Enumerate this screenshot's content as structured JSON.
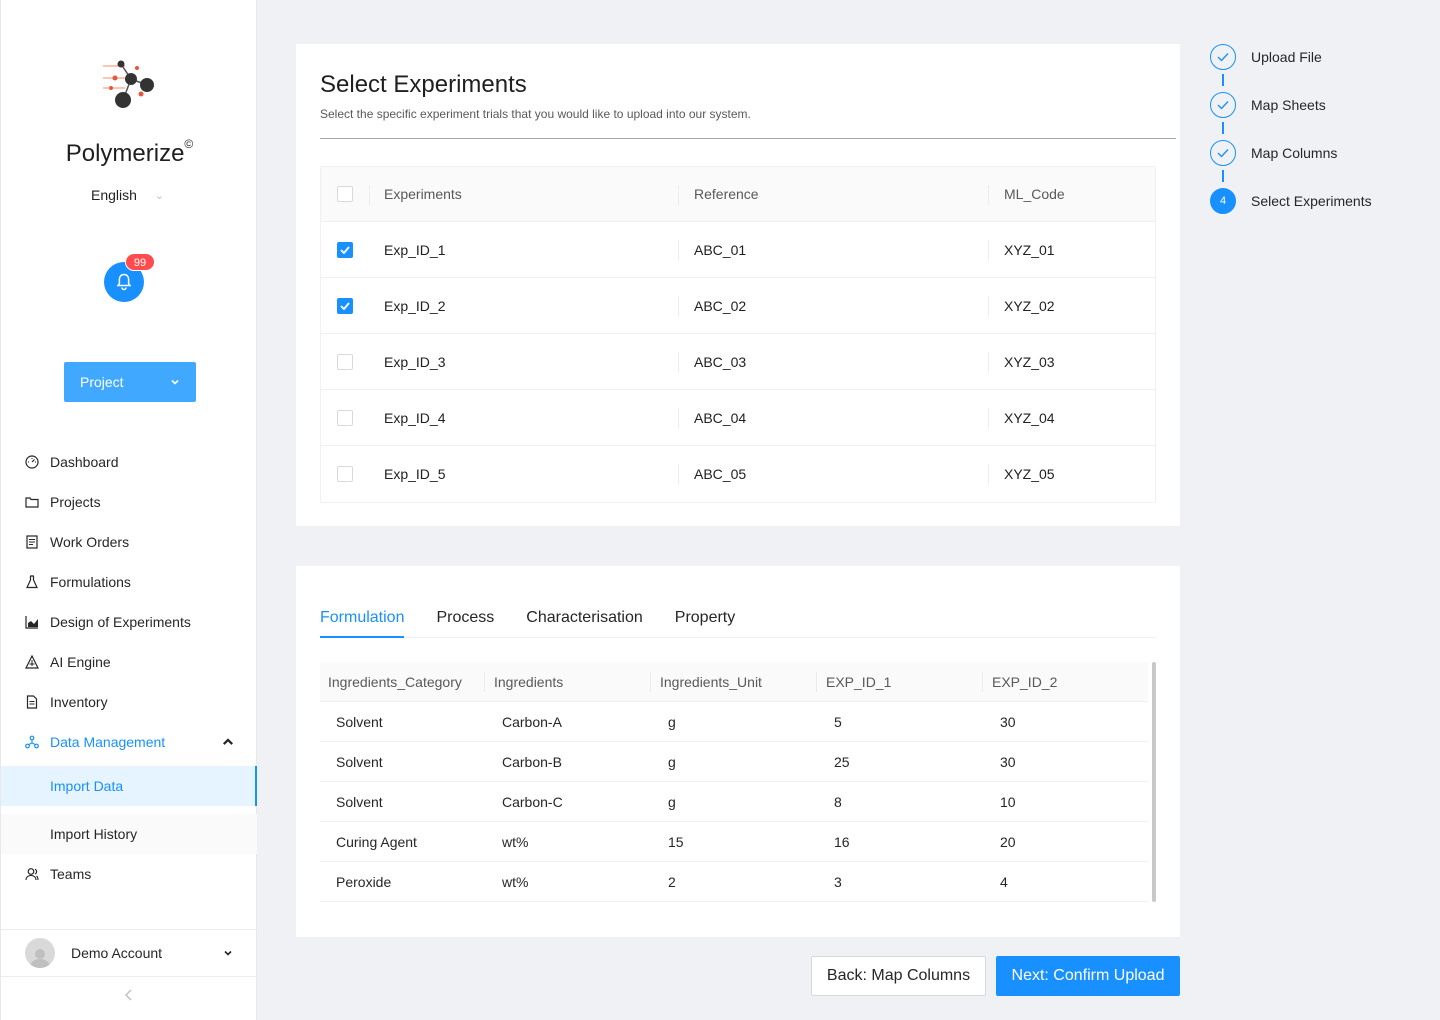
{
  "app": {
    "brand": "Polymerize",
    "brand_mark": "©",
    "language": "English",
    "notifications_count": "99",
    "project_button": "Project"
  },
  "nav": {
    "items": [
      {
        "label": "Dashboard",
        "icon": "dashboard-icon"
      },
      {
        "label": "Projects",
        "icon": "folder-icon"
      },
      {
        "label": "Work Orders",
        "icon": "work-order-icon"
      },
      {
        "label": "Formulations",
        "icon": "flask-icon"
      },
      {
        "label": "Design of Experiments",
        "icon": "chart-icon"
      },
      {
        "label": "AI Engine",
        "icon": "ai-engine-icon"
      },
      {
        "label": "Inventory",
        "icon": "inventory-icon"
      }
    ],
    "data_management": {
      "label": "Data Management",
      "icon": "data-management-icon"
    },
    "sub_items": [
      "Import Data",
      "Import History"
    ],
    "teams": {
      "label": "Teams",
      "icon": "teams-icon"
    }
  },
  "account": {
    "name": "Demo Account"
  },
  "colors": {
    "primary": "#1890ff",
    "badge": "#ff4d4f"
  },
  "select_experiments": {
    "title": "Select Experiments",
    "subtitle": "Select the specific experiment trials that you would like to upload into our system.",
    "columns": [
      "Experiments",
      "Reference",
      "ML_Code"
    ],
    "rows": [
      {
        "checked": true,
        "experiment": "Exp_ID_1",
        "reference": "ABC_01",
        "ml_code": "XYZ_01"
      },
      {
        "checked": true,
        "experiment": "Exp_ID_2",
        "reference": "ABC_02",
        "ml_code": "XYZ_02"
      },
      {
        "checked": false,
        "experiment": "Exp_ID_3",
        "reference": "ABC_03",
        "ml_code": "XYZ_03"
      },
      {
        "checked": false,
        "experiment": "Exp_ID_4",
        "reference": "ABC_04",
        "ml_code": "XYZ_04"
      },
      {
        "checked": false,
        "experiment": "Exp_ID_5",
        "reference": "ABC_05",
        "ml_code": "XYZ_05"
      }
    ]
  },
  "preview": {
    "tabs": [
      "Formulation",
      "Process",
      "Characterisation",
      "Property"
    ],
    "active_tab": "Formulation",
    "columns": [
      "Ingredients_Category",
      "Ingredients",
      "Ingredients_Unit",
      "EXP_ID_1",
      "EXP_ID_2"
    ],
    "rows": [
      [
        "Solvent",
        "Carbon-A",
        "g",
        "5",
        "30"
      ],
      [
        "Solvent",
        "Carbon-B",
        "g",
        "25",
        "30"
      ],
      [
        "Solvent",
        "Carbon-C",
        "g",
        "8",
        "10"
      ],
      [
        "Curing Agent",
        "wt%",
        "15",
        "16",
        "20"
      ],
      [
        "Peroxide",
        "wt%",
        "2",
        "3",
        "4"
      ]
    ]
  },
  "buttons": {
    "back": "Back: Map Columns",
    "next": "Next: Confirm Upload"
  },
  "steps": [
    {
      "label": "Upload File",
      "status": "done"
    },
    {
      "label": "Map Sheets",
      "status": "done"
    },
    {
      "label": "Map Columns",
      "status": "done"
    },
    {
      "label": "Select Experiments",
      "status": "current",
      "number": "4"
    }
  ]
}
